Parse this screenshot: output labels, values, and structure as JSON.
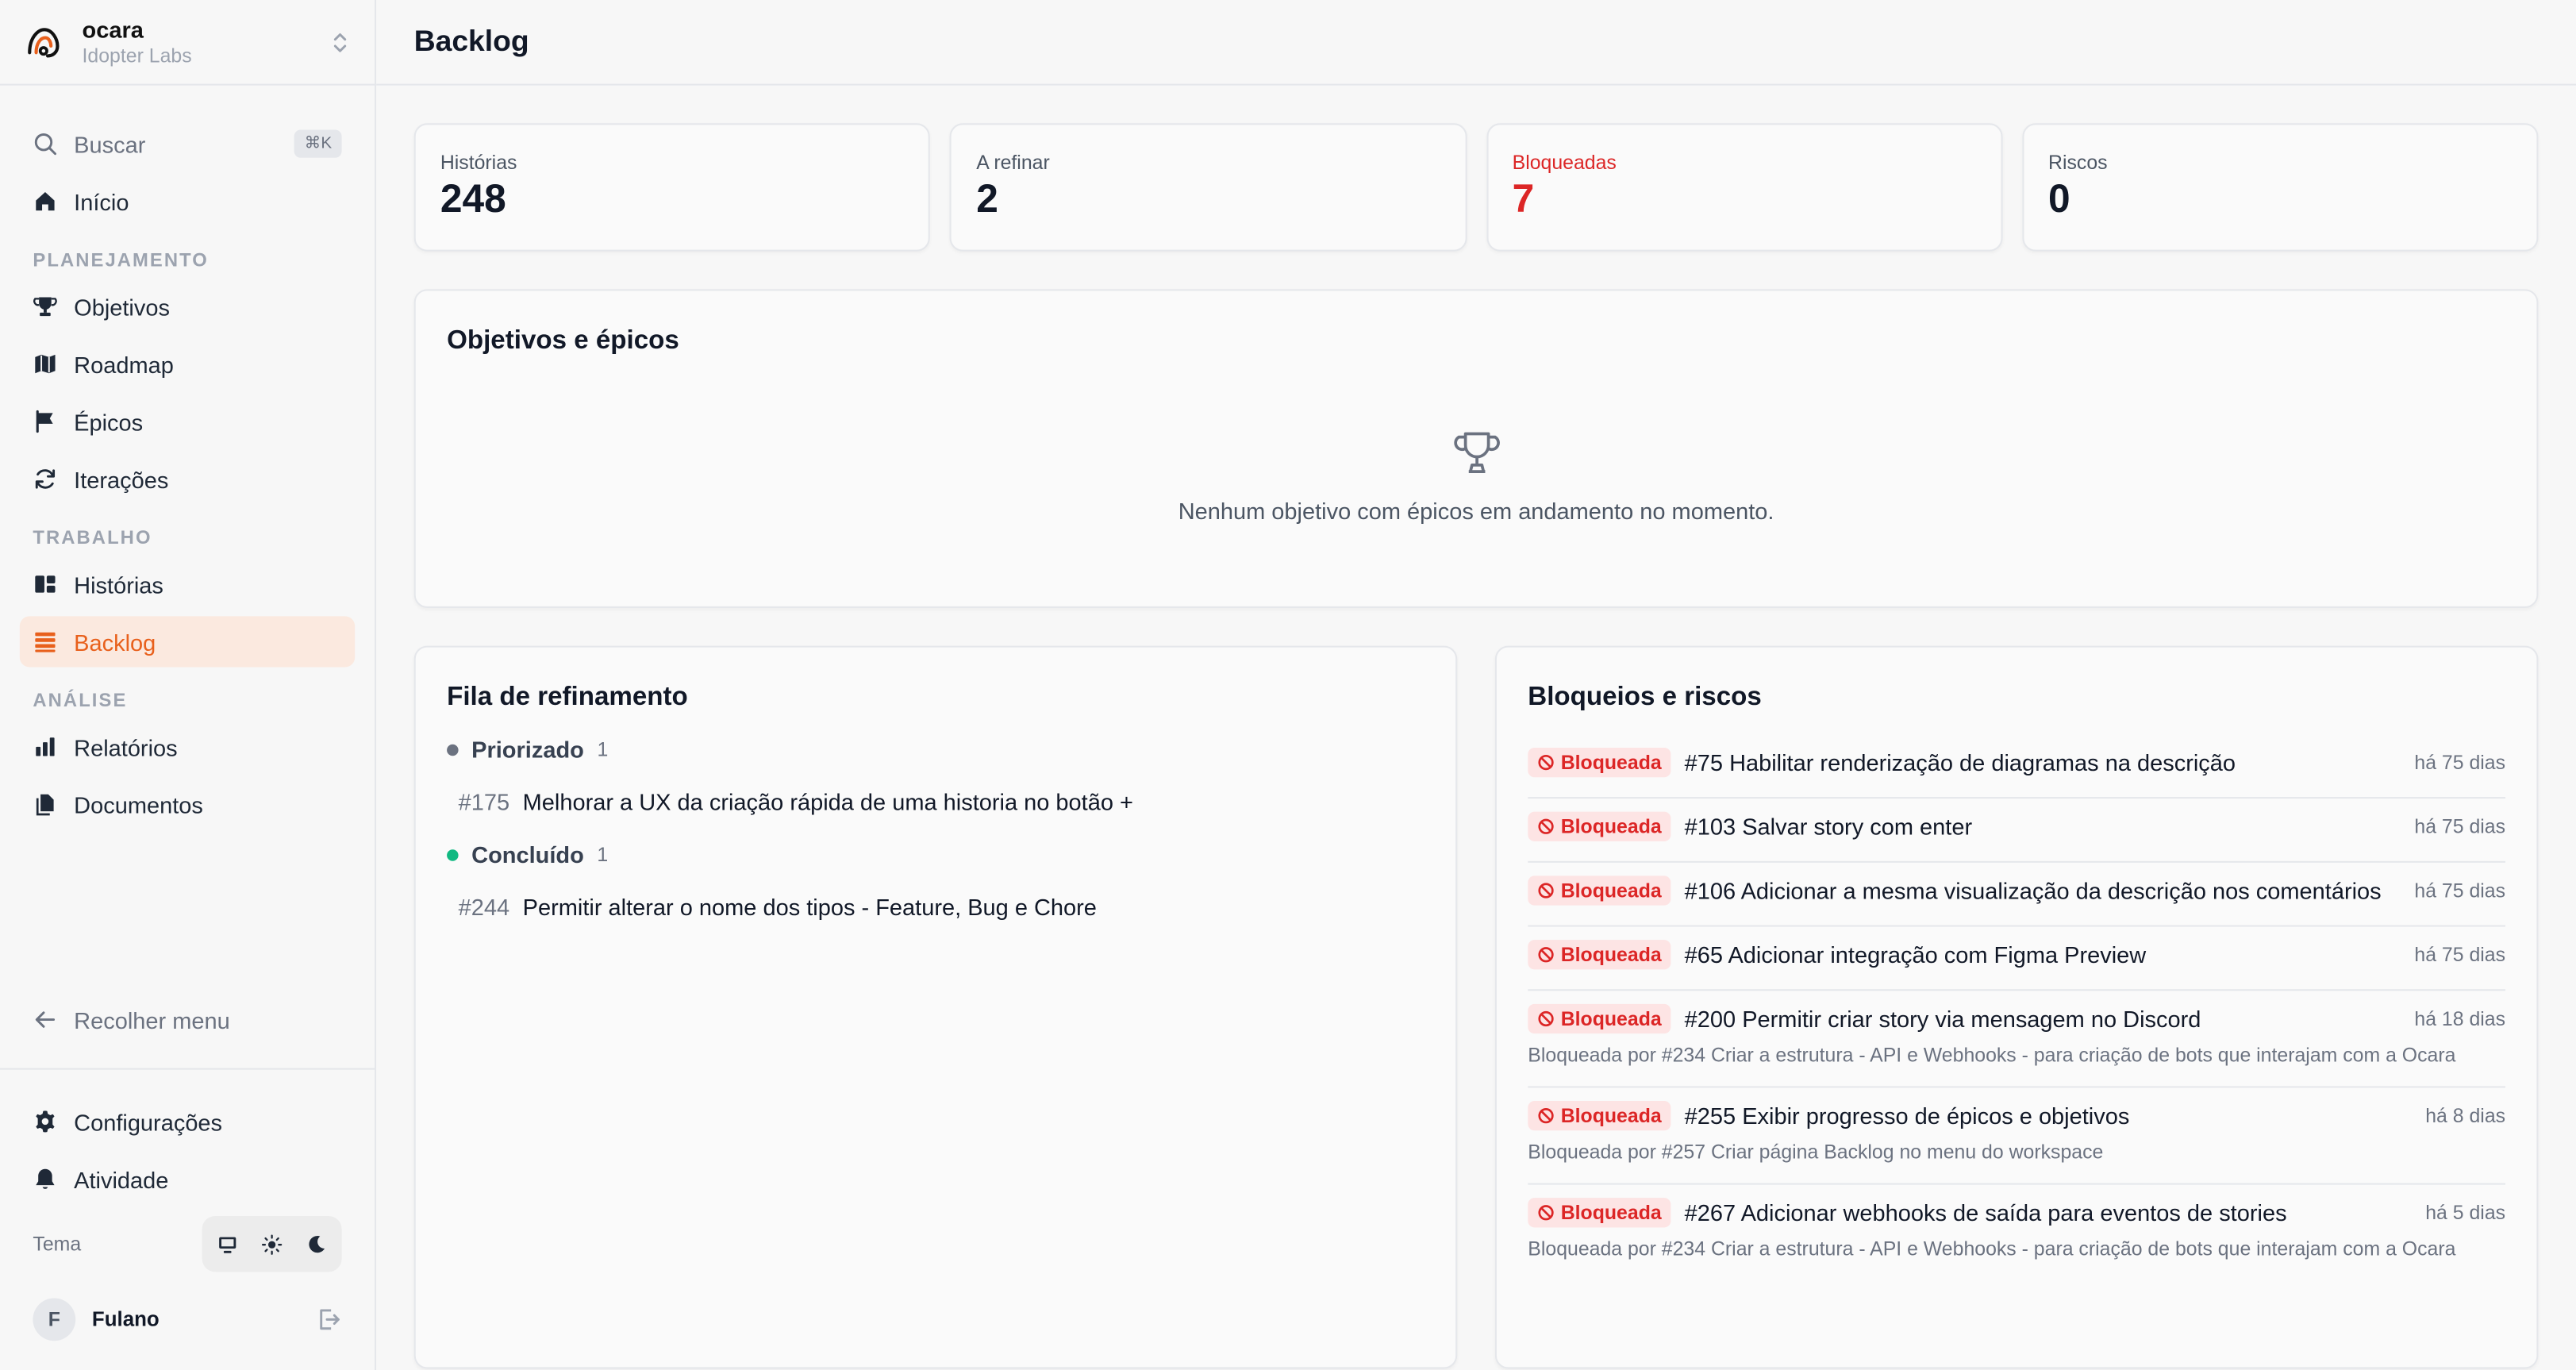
{
  "workspace": {
    "name": "ocara",
    "org": "Idopter Labs"
  },
  "sidebar": {
    "search_label": "Buscar",
    "search_shortcut": "⌘K",
    "home_label": "Início",
    "sections": [
      {
        "label": "PLANEJAMENTO",
        "items": [
          "Objetivos",
          "Roadmap",
          "Épicos",
          "Iterações"
        ]
      },
      {
        "label": "TRABALHO",
        "items": [
          "Histórias",
          "Backlog"
        ]
      },
      {
        "label": "ANÁLISE",
        "items": [
          "Relatórios",
          "Documentos"
        ]
      }
    ],
    "active_item": "Backlog",
    "collapse_label": "Recolher menu",
    "settings_label": "Configurações",
    "activity_label": "Atividade",
    "theme_label": "Tema",
    "theme_selected": "system",
    "user": {
      "initial": "F",
      "name": "Fulano"
    }
  },
  "page": {
    "title": "Backlog"
  },
  "stats": [
    {
      "label": "Histórias",
      "value": "248"
    },
    {
      "label": "A refinar",
      "value": "2"
    },
    {
      "label": "Bloqueadas",
      "value": "7"
    },
    {
      "label": "Riscos",
      "value": "0"
    }
  ],
  "goals": {
    "title": "Objetivos e épicos",
    "empty_text": "Nenhum objetivo com épicos em andamento no momento."
  },
  "queue": {
    "title": "Fila de refinamento",
    "groups": [
      {
        "name": "Priorizado",
        "count": "1",
        "color": "#6b7280",
        "items": [
          {
            "num": "#175",
            "title": "Melhorar a UX da criação rápida de uma historia no botão +"
          }
        ]
      },
      {
        "name": "Concluído",
        "count": "1",
        "color": "#10b981",
        "items": [
          {
            "num": "#244",
            "title": "Permitir alterar o nome dos tipos - Feature, Bug e Chore"
          }
        ]
      }
    ]
  },
  "blocks": {
    "title": "Bloqueios e riscos",
    "badge_label": "Bloqueada",
    "items": [
      {
        "title": "#75 Habilitar renderização de diagramas na descrição",
        "time": "há 75 dias"
      },
      {
        "title": "#103 Salvar story com enter",
        "time": "há 75 dias"
      },
      {
        "title": "#106 Adicionar a mesma visualização da descrição nos comentários",
        "time": "há 75 dias"
      },
      {
        "title": "#65 Adicionar integração com Figma Preview",
        "time": "há 75 dias"
      },
      {
        "title": "#200 Permitir criar story via mensagem no Discord",
        "time": "há 18 dias",
        "blocked_by": "Bloqueada por #234 Criar a estrutura - API e Webhooks - para criação de bots que interajam com a Ocara"
      },
      {
        "title": "#255 Exibir progresso de épicos e objetivos",
        "time": "há 8 dias",
        "blocked_by": "Bloqueada por #257 Criar página Backlog no menu do workspace"
      },
      {
        "title": "#267 Adicionar webhooks de saída para eventos de stories",
        "time": "há 5 dias",
        "blocked_by": "Bloqueada por #234 Criar a estrutura - API e Webhooks - para criação de bots que interajam com a Ocara"
      }
    ]
  },
  "colors": {
    "accent": "#e8601c",
    "danger": "#dc2626",
    "success": "#10b981"
  }
}
